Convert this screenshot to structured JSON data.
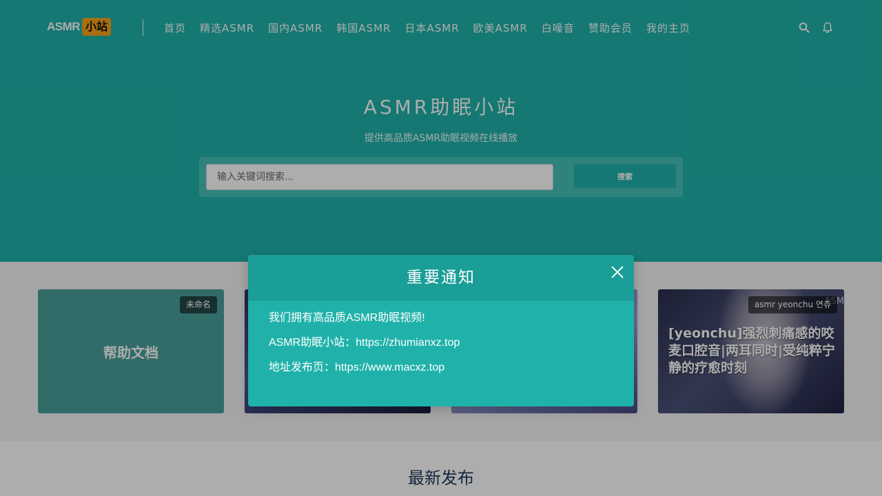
{
  "header": {
    "logo_text": "ASMR",
    "logo_badge": "小站",
    "nav": [
      "首页",
      "精选ASMR",
      "国内ASMR",
      "韩国ASMR",
      "日本ASMR",
      "欧美ASMR",
      "白噪音",
      "赞助会员",
      "我的主页"
    ],
    "icons": [
      "search-icon",
      "bell-icon"
    ]
  },
  "hero": {
    "title": "ASMR助眠小站",
    "subtitle": "提供高品质ASMR助眠视频在线播放",
    "search_placeholder": "输入关键词搜索...",
    "search_button": "搜索"
  },
  "cards": [
    {
      "tag": "未命名",
      "title": "帮助文档"
    },
    {
      "tag": "",
      "title": ""
    },
    {
      "tag": "",
      "title": ""
    },
    {
      "tag": "asmr yeonchu 연츄",
      "tag_extra": "ASM",
      "title": "[yeonchu]强烈刺痛感的咬麦口腔音|两耳同时|受纯粹宁静的疗愈时刻"
    }
  ],
  "latest": {
    "title": "最新发布"
  },
  "modal": {
    "title": "重要通知",
    "lines": [
      "我们拥有高品质ASMR助眠视频!",
      "ASMR助眠小站：https://zhumianxz.top",
      "地址发布页：https://www.macxz.top"
    ]
  },
  "colors": {
    "brand": "#1fb2a8",
    "modal_header": "#1a9e97",
    "logo_badge": "#f7a21b",
    "latest_title": "#1f3a5a"
  }
}
